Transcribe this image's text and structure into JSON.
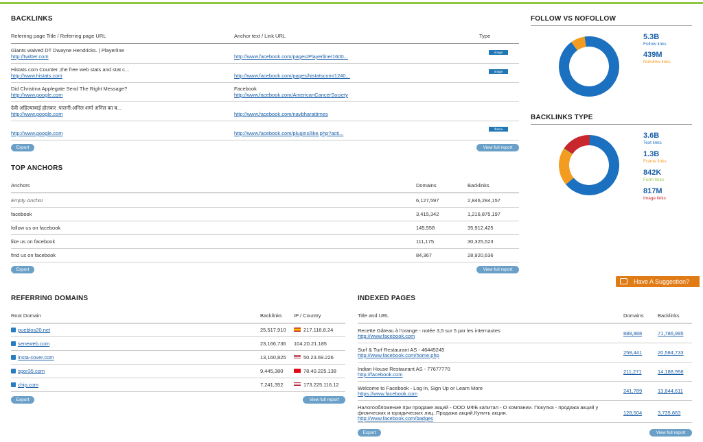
{
  "backlinks": {
    "title": "BACKLINKS",
    "cols": [
      "Referring page Title / Referring page URL",
      "Anchor text / Link URL",
      "Type"
    ],
    "rows": [
      {
        "title": "Giants waived DT Dwayne Hendricks. | Playerline",
        "url": "http://twitter.com",
        "anchor": "",
        "link": "http://www.facebook.com/pages/Playerline/1600...",
        "badge": "image"
      },
      {
        "title": "Histats.com Counter ,the free web stats and stat c...",
        "url": "http://www.histats.com",
        "anchor": "",
        "link": "http://www.facebook.com/pages/histatscom/1240...",
        "badge": "image"
      },
      {
        "title": "Did Christina Applegate Send The Right Message?",
        "url": "http://www.google.com",
        "anchor": "Facebook",
        "link": "http://www.facebook.com/AmericanCancerSociety",
        "badge": ""
      },
      {
        "title": "देवी अहिल्याबाई होलकर :पालनी:अनिल शर्मा अनिल का ब...",
        "url": "http://www.google.com",
        "anchor": "",
        "link": "http://www.facebook.com/navbharattimes",
        "badge": ""
      },
      {
        "title": "",
        "url": "http://www.google.com",
        "anchor": "",
        "link": "http://www.facebook.com/plugins/like.php?acti...",
        "badge": "iframe"
      }
    ],
    "export": "Export",
    "full": "View full report"
  },
  "anchors": {
    "title": "TOP ANCHORS",
    "cols": [
      "Anchors",
      "Domains",
      "Backlinks"
    ],
    "rows": [
      {
        "a": "Empty Anchor",
        "d": "6,127,597",
        "b": "2,846,284,157"
      },
      {
        "a": "facebook",
        "d": "3,415,342",
        "b": "1,216,875,197"
      },
      {
        "a": "follow us on facebook",
        "d": "145,558",
        "b": "35,912,425"
      },
      {
        "a": "like us on facebook",
        "d": "111,175",
        "b": "30,325,523"
      },
      {
        "a": "find us on facebook",
        "d": "84,367",
        "b": "28,920,636"
      }
    ],
    "export": "Export",
    "full": "View full report"
  },
  "follow": {
    "title": "FOLLOW VS NOFOLLOW",
    "items": [
      {
        "value": "5.3B",
        "label": "Follow links",
        "color": "#1b70c0",
        "share": 0.924
      },
      {
        "value": "439M",
        "label": "Nofollow links",
        "color": "#f39c1f",
        "share": 0.076
      }
    ]
  },
  "btype": {
    "title": "BACKLINKS TYPE",
    "items": [
      {
        "value": "3.6B",
        "label": "Text links",
        "color": "#1b70c0",
        "share": 0.64
      },
      {
        "value": "1.3B",
        "label": "Frame links",
        "color": "#f39c1f",
        "share": 0.2
      },
      {
        "value": "842K",
        "label": "Form links",
        "color": "#8dc63f",
        "share": 0.001
      },
      {
        "value": "817M",
        "label": "Image links",
        "color": "#c8272d",
        "share": 0.159
      }
    ]
  },
  "refdomains": {
    "title": "REFERRING DOMAINS",
    "cols": [
      "Root Domain",
      "Backlinks",
      "IP / Country"
    ],
    "rows": [
      {
        "domain": "pueblos20.net",
        "backlinks": "25,517,910",
        "ip": "217.116.8.24",
        "flag": "es"
      },
      {
        "domain": "seneweb.com",
        "backlinks": "23,166,736",
        "ip": "104.20.21.185",
        "flag": ""
      },
      {
        "domain": "insta-cover.com",
        "backlinks": "13,160,825",
        "ip": "50.23.69.226",
        "flag": "us"
      },
      {
        "domain": "spor35.com",
        "backlinks": "9,445,380",
        "ip": "78.40.225.138",
        "flag": "tr"
      },
      {
        "domain": "chip.com",
        "backlinks": "7,241,352",
        "ip": "173.225.116.12",
        "flag": "us"
      }
    ],
    "export": "Export",
    "full": "View full report"
  },
  "indexed": {
    "title": "INDEXED PAGES",
    "cols": [
      "Title and URL",
      "Domains",
      "Backlinks"
    ],
    "rows": [
      {
        "title": "Recette Gâteau à l'orange - notée 3,5 sur 5 par les internautes",
        "url": "http://www.facebook.com",
        "d": "888,888",
        "b": "71,786,995"
      },
      {
        "title": "Surf & Turf Restaurant AS - 46445245",
        "url": "http://www.facebook.com/home.php",
        "d": "258,441",
        "b": "20,584,733"
      },
      {
        "title": "Indian House Restaurant AS - 77677770",
        "url": "http://facebook.com",
        "d": "211,271",
        "b": "14,188,958"
      },
      {
        "title": "Welcome to Facebook - Log In, Sign Up or Learn More",
        "url": "https://www.facebook.com",
        "d": "241,789",
        "b": "13,844,611"
      },
      {
        "title": "Налогообложение при продаже акций - ООО МФБ капитал - О компании. Покупка - продажа акций у",
        "title2": "физических и юридических лиц. Продажа акций.Купить акции.",
        "url": "http://www.facebook.com/badges",
        "d": "128,504",
        "b": "3,735,863"
      }
    ],
    "export": "Export",
    "full": "View full report"
  },
  "suggestion": "Have A Suggestion?"
}
